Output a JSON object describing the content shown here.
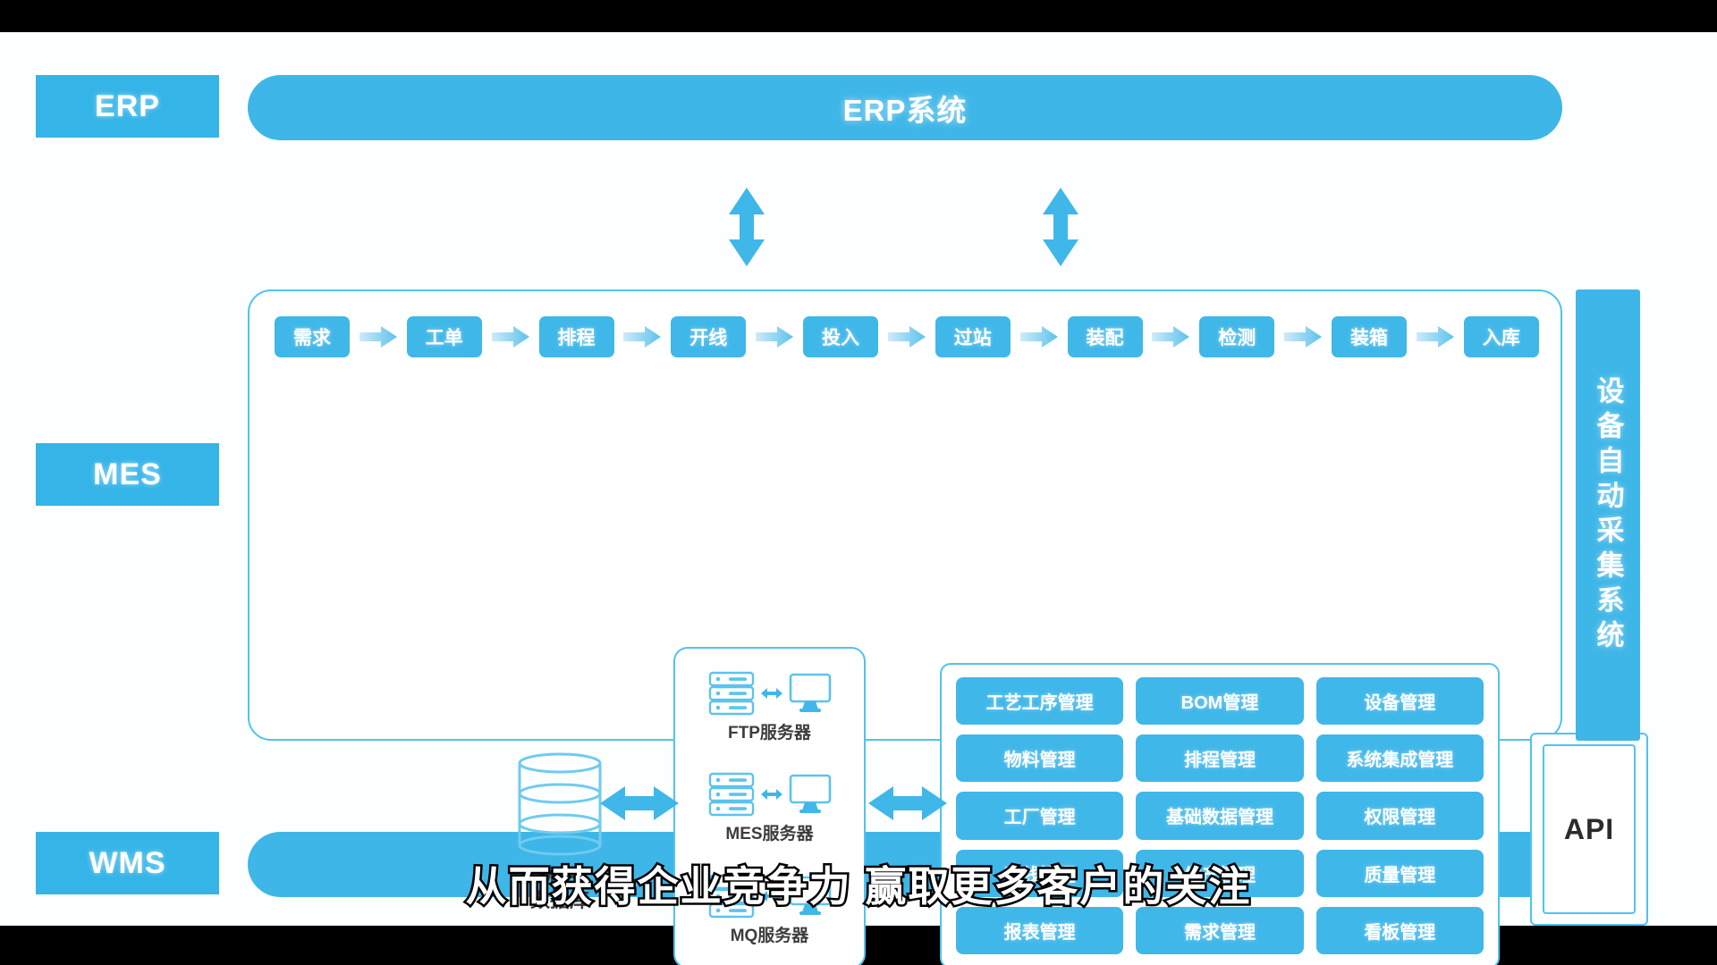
{
  "colors": {
    "accent": "#35b4e8",
    "accent_light": "#3fb7e9",
    "border": "#4fc3ef",
    "background": "#fdfeff",
    "letterbox": "#000000",
    "text_dark": "#3a3a3a",
    "text_light": "#ffffff"
  },
  "categories": {
    "erp": "ERP",
    "mes": "MES",
    "wms": "WMS"
  },
  "bars": {
    "erp_title": "ERP系统",
    "wms_title": ""
  },
  "flow": {
    "steps": [
      {
        "label": "需求"
      },
      {
        "label": "工单"
      },
      {
        "label": "排程"
      },
      {
        "label": "开线"
      },
      {
        "label": "投入"
      },
      {
        "label": "过站"
      },
      {
        "label": "装配"
      },
      {
        "label": "检测"
      },
      {
        "label": "装箱"
      },
      {
        "label": "入库"
      }
    ]
  },
  "database": {
    "line1": "MES",
    "line2": "数据库"
  },
  "servers": [
    {
      "label": "FTP服务器"
    },
    {
      "label": "MES服务器"
    },
    {
      "label": "MQ服务器"
    }
  ],
  "modules": [
    {
      "label": "工艺工序管理"
    },
    {
      "label": "BOM管理"
    },
    {
      "label": "设备管理"
    },
    {
      "label": "物料管理"
    },
    {
      "label": "排程管理"
    },
    {
      "label": "系统集成管理"
    },
    {
      "label": "工厂管理"
    },
    {
      "label": "基础数据管理"
    },
    {
      "label": "权限管理"
    },
    {
      "label": "开线管理"
    },
    {
      "label": "生产管理"
    },
    {
      "label": "质量管理"
    },
    {
      "label": "报表管理"
    },
    {
      "label": "需求管理"
    },
    {
      "label": "看板管理"
    }
  ],
  "api": {
    "label": "API"
  },
  "right_panel": {
    "label": "设备自动采集系统"
  },
  "subtitle": {
    "text": "从而获得企业竞争力 赢取更多客户的关注"
  }
}
